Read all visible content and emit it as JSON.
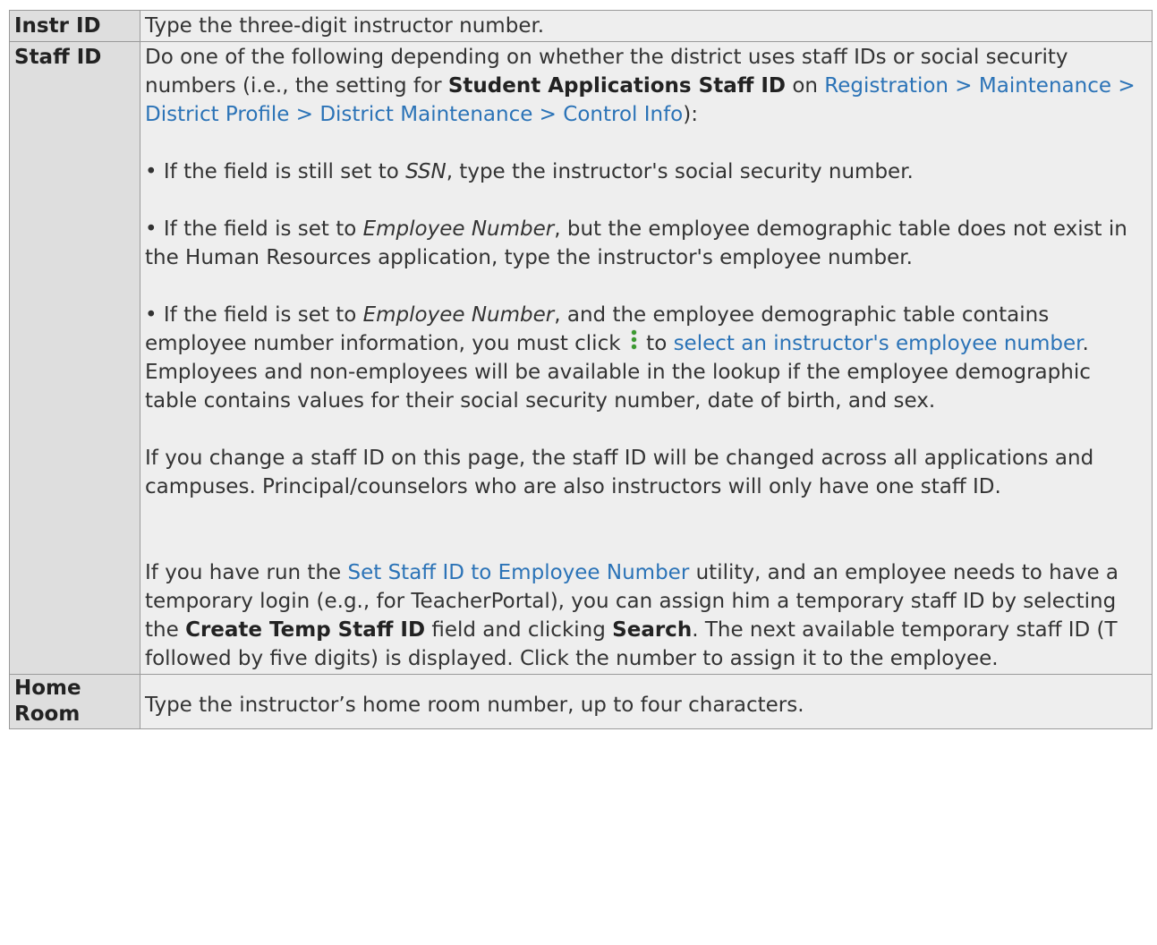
{
  "rows": [
    {
      "field": "Instr ID",
      "description": "Type the three-digit instructor number."
    },
    {
      "field": "Staff ID",
      "intro": {
        "text1": "Do one of the following depending on whether the district uses staff IDs or social security numbers (i.e., the setting for ",
        "bold1": "Student Applications Staff ID",
        "text2": " on ",
        "link": "Registration > Maintenance > District Profile > District Maintenance > Control Info",
        "text3": "):"
      },
      "bullet1": {
        "text1": "• If the field is still set to ",
        "em": "SSN",
        "text2": ", type the instructor's social security number."
      },
      "bullet2": {
        "text1": "• If the field is set to ",
        "em": "Employee Number",
        "text2": ", but the employee demographic table does not exist in the Human Resources application, type the instructor's employee number."
      },
      "bullet3": {
        "text1": "• If the field is set to ",
        "em": "Employee Number",
        "text2": ", and the employee demographic table contains employee number information, you must click ",
        "icon": "lookup-icon",
        "text3": " to ",
        "link": "select an instructor's employee number",
        "text4": ". Employees and non-employees will be available in the lookup if the employee demographic table contains values for their social security number, date of birth, and sex."
      },
      "note": "If you change a staff ID on this page, the staff ID will be changed across all applications and campuses. Principal/counselors who are also instructors will only have one staff ID.",
      "temp": {
        "text1": "If you have run the ",
        "link": "Set Staff ID to Employee Number",
        "text2": " utility, and an employee needs to have a temporary login (e.g., for TeacherPortal), you can assign him a temporary staff ID by selecting the ",
        "bold1": "Create Temp Staff ID",
        "text3": " field and clicking ",
        "bold2": "Search",
        "text4": ". The next available temporary staff ID (T followed by five digits) is displayed. Click the number to assign it to the employee."
      }
    },
    {
      "field": "Home Room",
      "description": "Type the instructor’s home room number, up to four characters."
    }
  ],
  "colors": {
    "link": "#2b73b7",
    "icon": "#3a9a2e",
    "header_bg": "#dedede",
    "cell_bg": "#eeeeee"
  }
}
